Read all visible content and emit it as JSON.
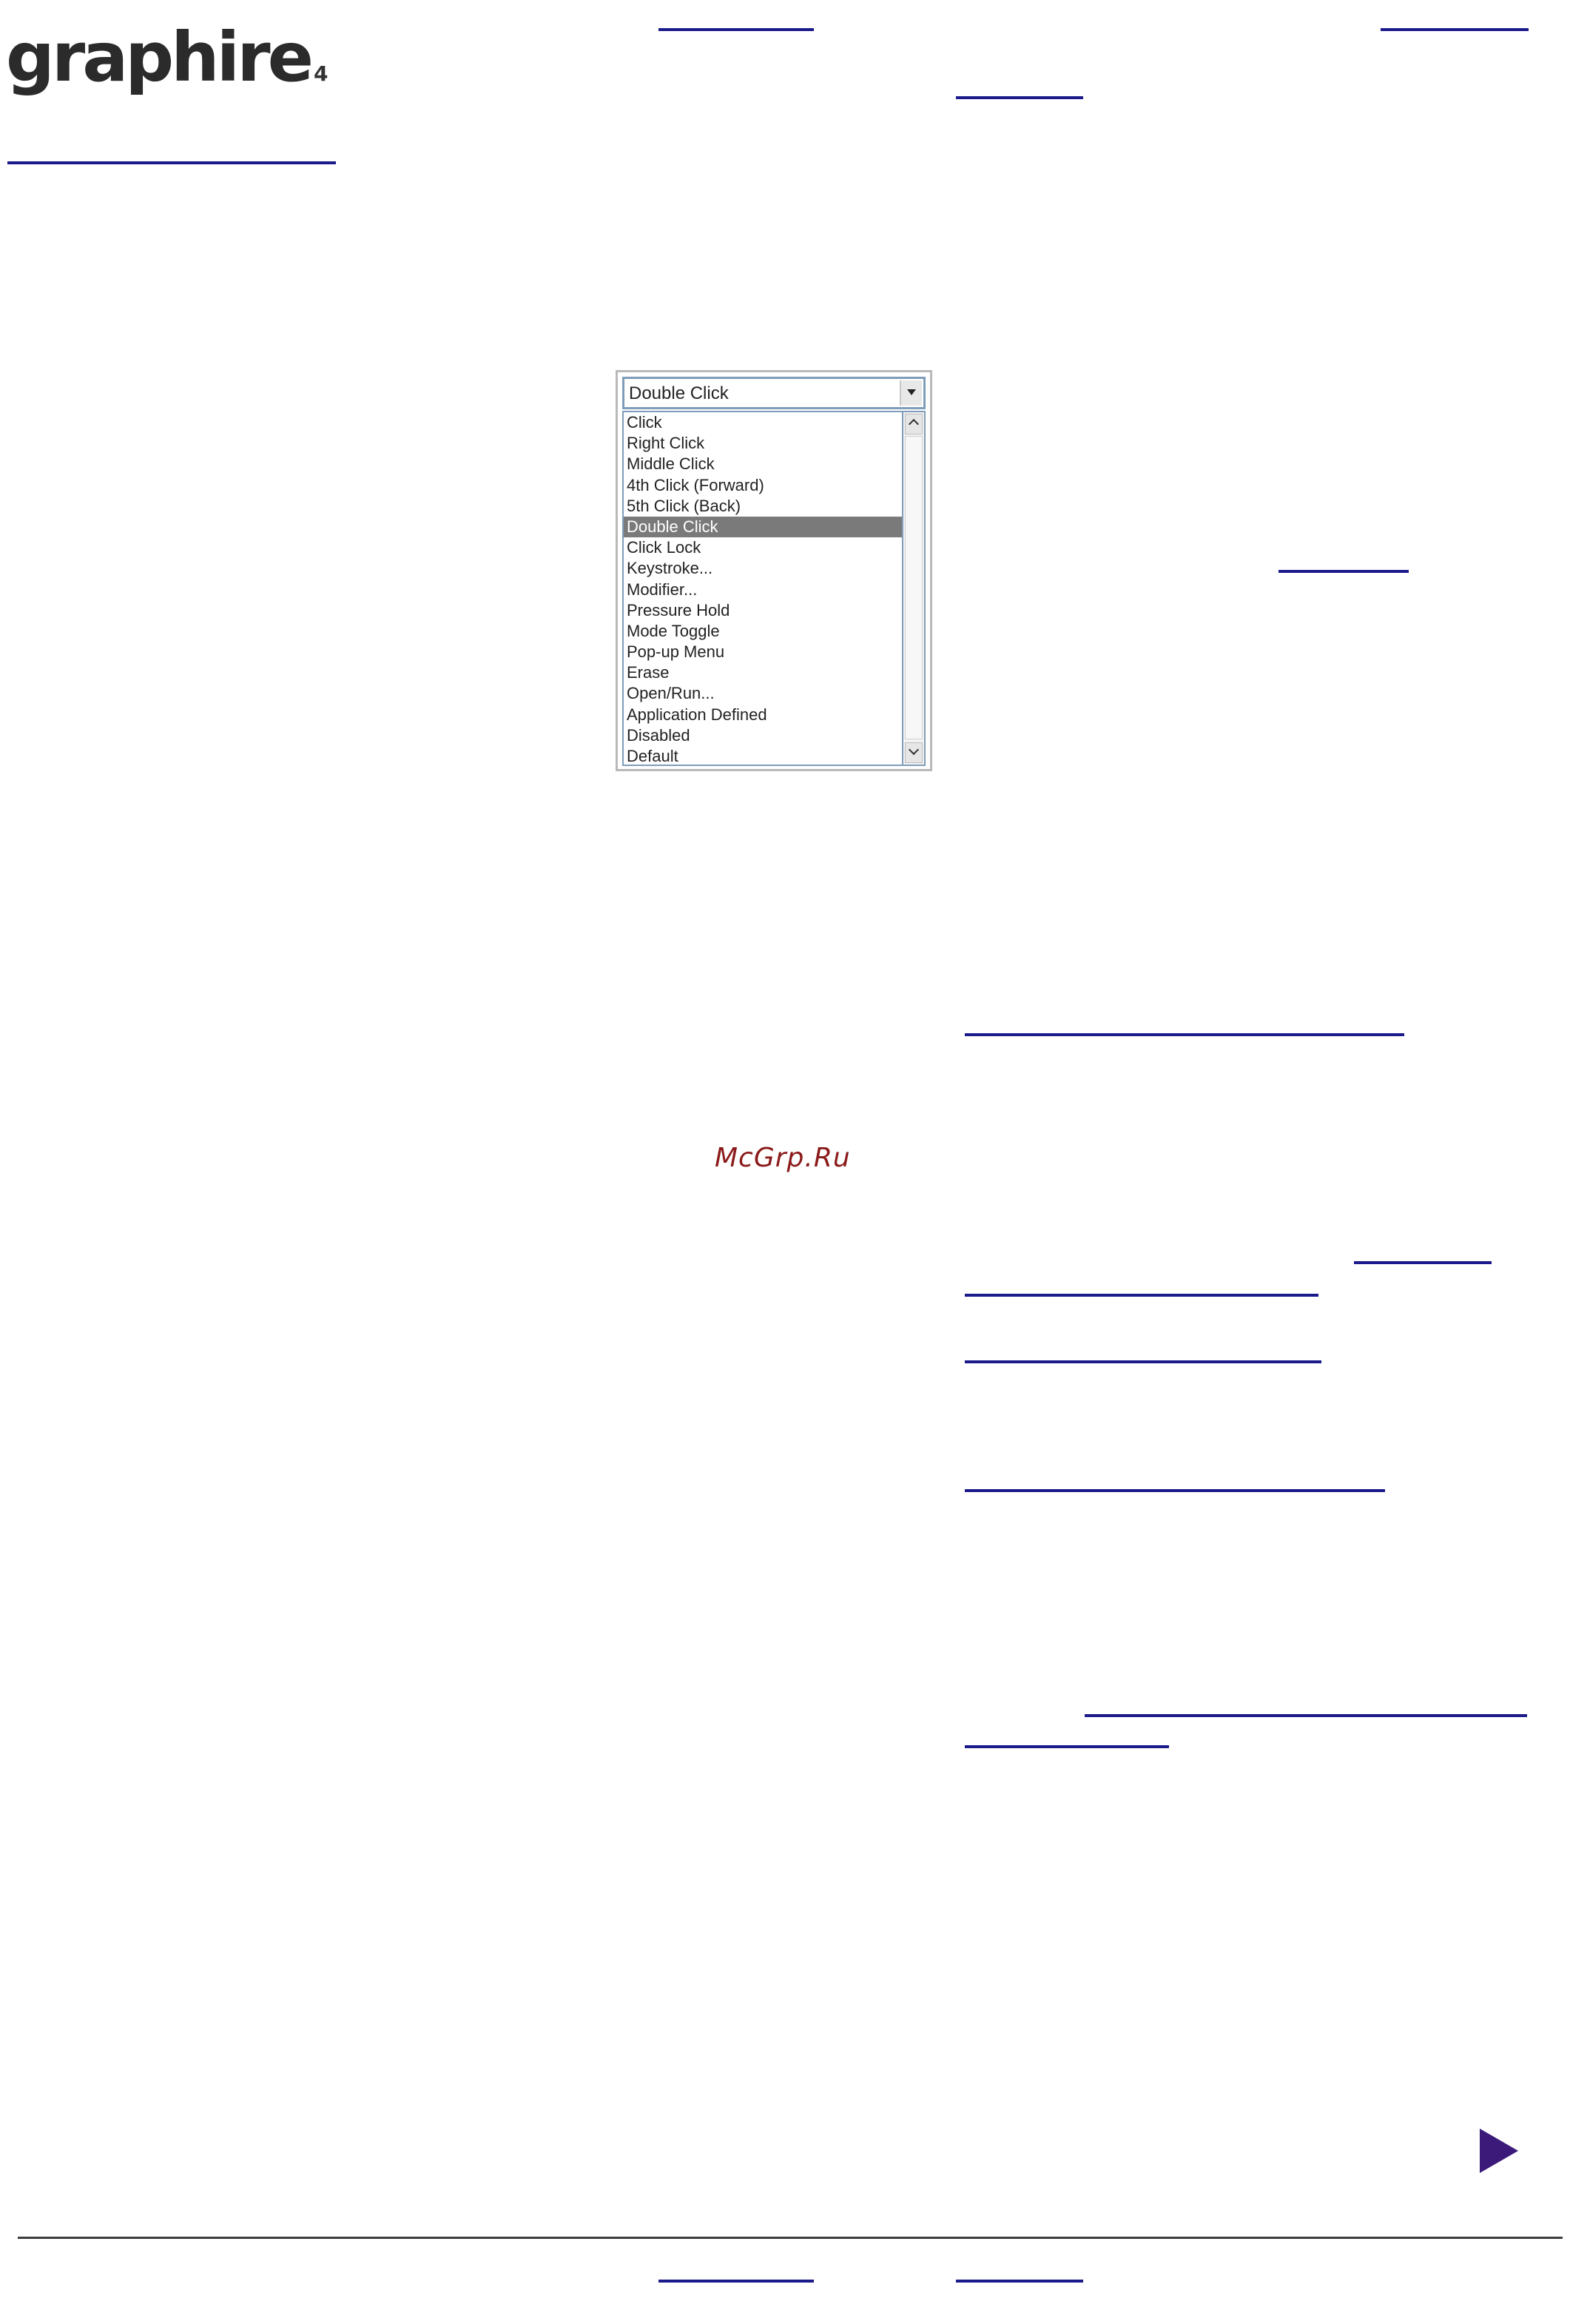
{
  "logo": {
    "text": "graphire",
    "sub": "4"
  },
  "dropdown": {
    "selected_value": "Double Click",
    "options": [
      "Click",
      "Right Click",
      "Middle Click",
      "4th Click (Forward)",
      "5th Click (Back)",
      "Double Click",
      "Click Lock",
      "Keystroke...",
      "Modifier...",
      "Pressure Hold",
      "Mode Toggle",
      "Pop-up Menu",
      "Erase",
      "Open/Run...",
      "Application Defined",
      "Disabled",
      "Default"
    ],
    "highlighted_index": 5
  },
  "watermark": "McGrp.Ru",
  "colors": {
    "link": "#1a1a8a",
    "selected_bg": "#7a7a7a",
    "watermark": "#8b1a1a",
    "next_arrow": "#3b1a7a"
  }
}
